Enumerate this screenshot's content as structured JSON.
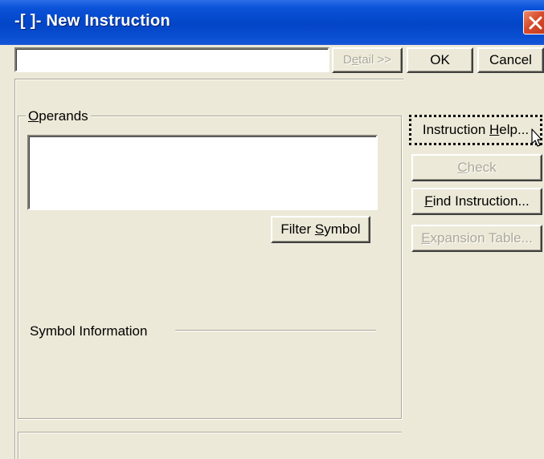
{
  "window": {
    "title": "-[ ]- New Instruction",
    "close_icon": "close-x-icon"
  },
  "instruction_input": {
    "value": ""
  },
  "buttons": {
    "detail": {
      "pre": "D",
      "u": "e",
      "post": "tail >>",
      "enabled": false
    },
    "ok": {
      "label": "OK"
    },
    "cancel": {
      "label": "Cancel"
    },
    "filter_symbol": {
      "pre": "Filter ",
      "u": "S",
      "post": "ymbol"
    },
    "instruction_help": {
      "pre": "Instruction ",
      "u": "H",
      "post": "elp...",
      "focused": true
    },
    "check": {
      "pre": "",
      "u": "C",
      "post": "heck",
      "enabled": false
    },
    "find_instruction": {
      "pre": "",
      "u": "F",
      "post": "ind Instruction..."
    },
    "expansion_table": {
      "pre": "",
      "u": "E",
      "post": "xpansion Table...",
      "enabled": false
    }
  },
  "operands": {
    "label_u": "O",
    "label_rest": "perands",
    "value": ""
  },
  "symbol_information": {
    "label": "Symbol Information"
  },
  "status": {
    "text": ""
  },
  "colors": {
    "titlebar": "#0345c6",
    "face": "#ece9d8",
    "close": "#d84b2c",
    "disabled_text": "#aca899"
  },
  "cursor_icon": "arrow-pointer-icon"
}
